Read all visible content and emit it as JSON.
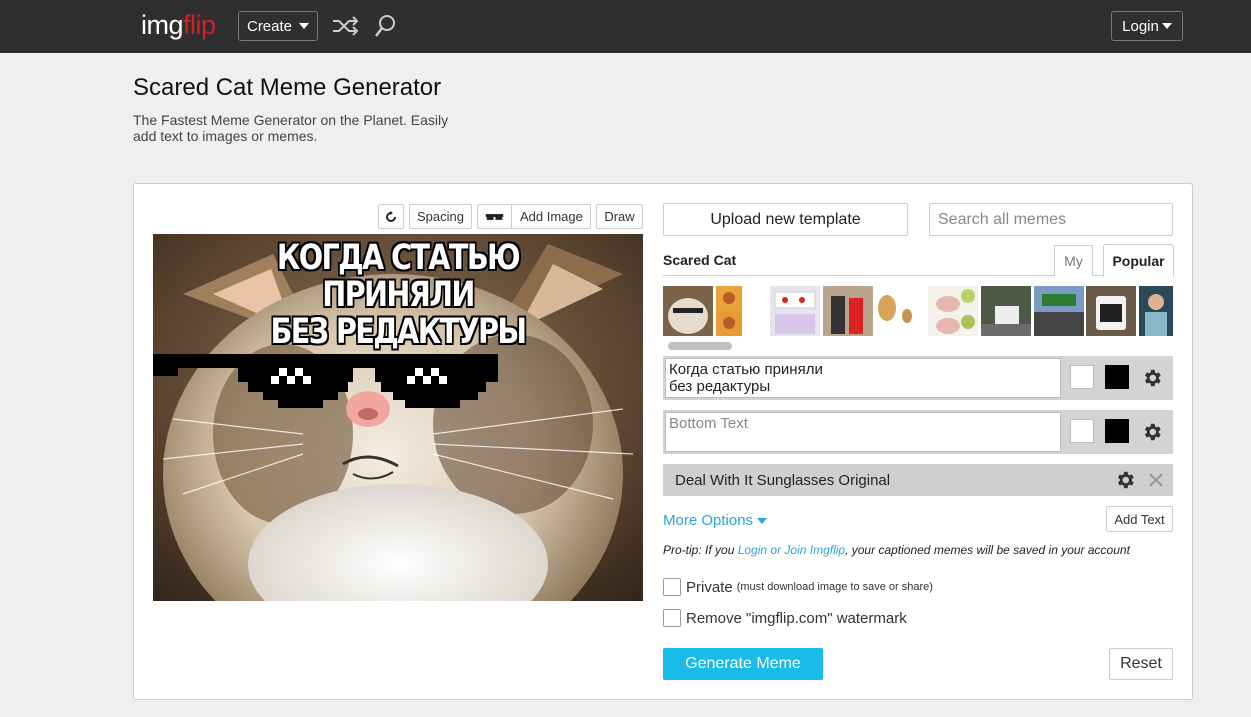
{
  "nav": {
    "logo_left": "img",
    "logo_right": "flip",
    "create_label": "Create",
    "login_label": "Login"
  },
  "page": {
    "title": "Scared Cat Meme Generator",
    "subtitle": "The Fastest Meme Generator on the Planet. Easily add text to images or memes."
  },
  "toolbar": {
    "spacing_label": "Spacing",
    "add_image_label": "Add Image",
    "draw_label": "Draw"
  },
  "meme": {
    "top_text": "КОГДА СТАТЬЮ ПРИНЯЛИ\nБЕЗ РЕДАКТУРЫ"
  },
  "right": {
    "upload_label": "Upload new template",
    "search_placeholder": "Search all memes",
    "template_name": "Scared Cat",
    "tab_my": "My",
    "tab_popular": "Popular"
  },
  "text_boxes": [
    {
      "value": "Когда статью приняли\nбез редактуры",
      "placeholder": ""
    },
    {
      "value": "",
      "placeholder": "Bottom Text"
    }
  ],
  "overlay": {
    "label": "Deal With It Sunglasses Original"
  },
  "options": {
    "more_options_label": "More Options",
    "add_text_label": "Add Text",
    "protip_prefix": "Pro-tip: If you ",
    "protip_link": "Login or Join Imgflip",
    "protip_suffix": ", your captioned memes will be saved in your account",
    "private_label": "Private",
    "private_note": "(must download image to save or share)",
    "watermark_label": "Remove \"imgflip.com\" watermark"
  },
  "actions": {
    "generate_label": "Generate Meme",
    "reset_label": "Reset"
  },
  "colors": {
    "topbar": "#2f2f2f",
    "logo_accent": "#d0202a",
    "link": "#2aa6d8",
    "generate": "#19bbe8"
  }
}
